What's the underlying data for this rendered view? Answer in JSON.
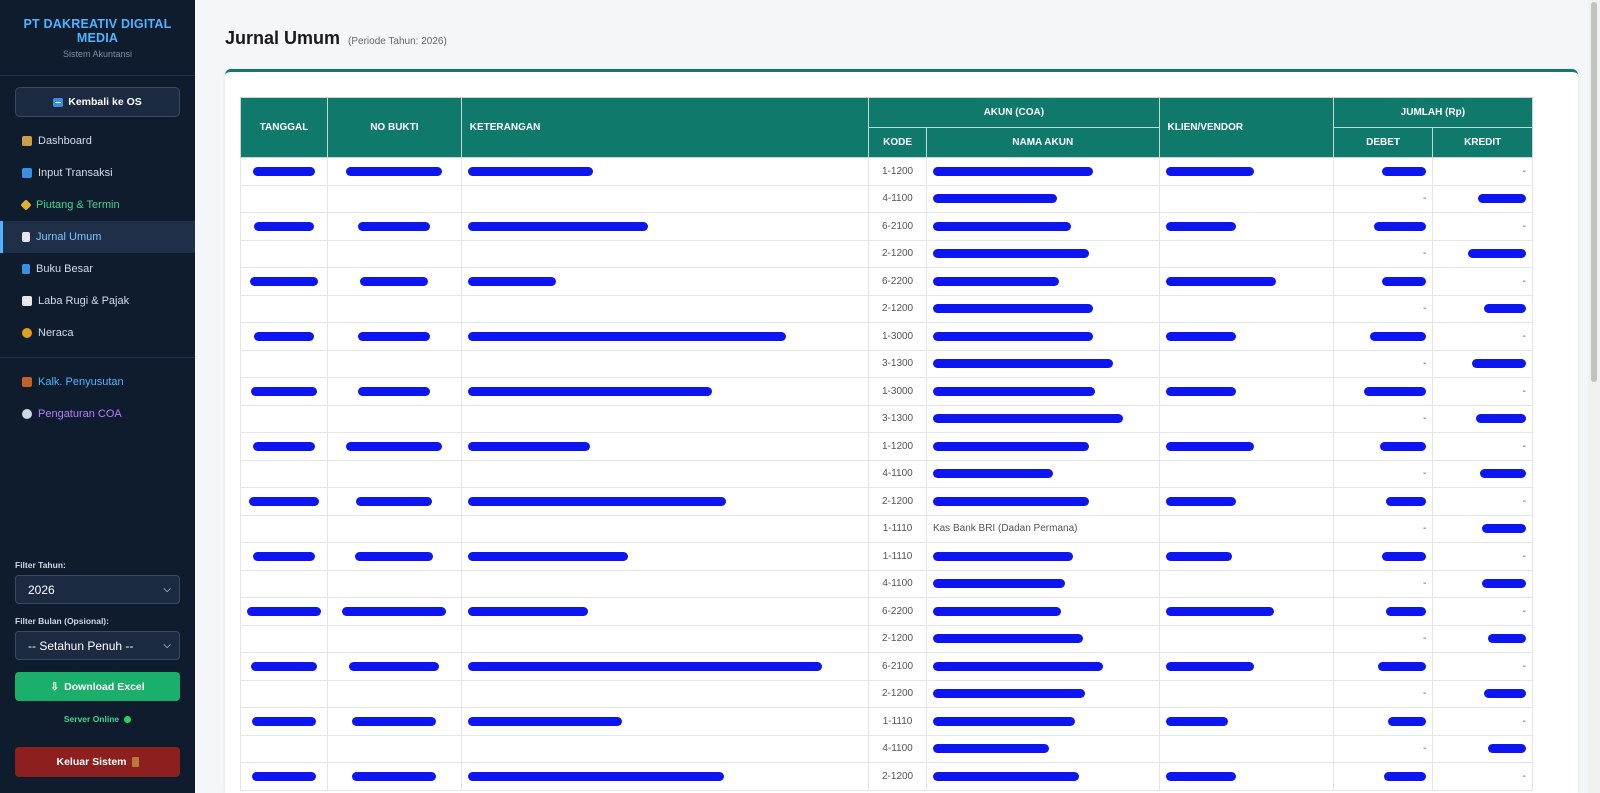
{
  "sidebar": {
    "company": "PT DAKREATIV DIGITAL MEDIA",
    "subtitle": "Sistem Akuntansi",
    "back_label": "Kembali ke OS",
    "nav": [
      {
        "label": "Dashboard",
        "icon": "chart-icon"
      },
      {
        "label": "Input Transaksi",
        "icon": "card-icon"
      },
      {
        "label": "Piutang & Termin",
        "icon": "tag-icon"
      },
      {
        "label": "Jurnal Umum",
        "icon": "journal-icon"
      },
      {
        "label": "Buku Besar",
        "icon": "book-icon"
      },
      {
        "label": "Laba Rugi & Pajak",
        "icon": "trend-icon"
      },
      {
        "label": "Neraca",
        "icon": "scale-icon"
      },
      {
        "label": "Kalk. Penyusutan",
        "icon": "abacus-icon"
      },
      {
        "label": "Pengaturan COA",
        "icon": "gear-icon"
      }
    ],
    "filter_year_label": "Filter Tahun:",
    "filter_year_value": "2026",
    "filter_month_label": "Filter Bulan (Opsional):",
    "filter_month_value": "-- Setahun Penuh --",
    "download_label": "Download Excel",
    "server_status": "Server Online",
    "logout_label": "Keluar Sistem"
  },
  "main": {
    "title": "Jurnal Umum",
    "period": "(Periode Tahun: 2026)",
    "table": {
      "headers": {
        "tanggal": "TANGGAL",
        "no_bukti": "NO BUKTI",
        "keterangan": "KETERANGAN",
        "akun": "AKUN (COA)",
        "kode": "KODE",
        "nama_akun": "NAMA AKUN",
        "klien": "KLIEN/VENDOR",
        "jumlah": "JUMLAH (Rp)",
        "debet": "DEBET",
        "kredit": "KREDIT"
      },
      "rows": [
        {
          "kode": "1-1200",
          "nama": "",
          "debet": "",
          "kredit": "-"
        },
        {
          "kode": "4-1100",
          "nama": "",
          "debet": "-",
          "kredit": ""
        },
        {
          "kode": "6-2100",
          "nama": "",
          "debet": "",
          "kredit": "-"
        },
        {
          "kode": "2-1200",
          "nama": "",
          "debet": "-",
          "kredit": ""
        },
        {
          "kode": "6-2200",
          "nama": "",
          "debet": "",
          "kredit": "-"
        },
        {
          "kode": "2-1200",
          "nama": "",
          "debet": "-",
          "kredit": ""
        },
        {
          "kode": "1-3000",
          "nama": "",
          "debet": "",
          "kredit": "-"
        },
        {
          "kode": "3-1300",
          "nama": "",
          "debet": "-",
          "kredit": ""
        },
        {
          "kode": "1-3000",
          "nama": "",
          "debet": "",
          "kredit": "-"
        },
        {
          "kode": "3-1300",
          "nama": "",
          "debet": "-",
          "kredit": ""
        },
        {
          "kode": "1-1200",
          "nama": "",
          "debet": "",
          "kredit": "-"
        },
        {
          "kode": "4-1100",
          "nama": "",
          "debet": "-",
          "kredit": ""
        },
        {
          "kode": "2-1200",
          "nama": "",
          "debet": "",
          "kredit": "-"
        },
        {
          "kode": "1-1110",
          "nama": "Kas Bank BRI (Dadan Permana)",
          "debet": "-",
          "kredit": ""
        },
        {
          "kode": "1-1110",
          "nama": "",
          "debet": "",
          "kredit": "-"
        },
        {
          "kode": "4-1100",
          "nama": "",
          "debet": "-",
          "kredit": ""
        },
        {
          "kode": "6-2200",
          "nama": "",
          "debet": "",
          "kredit": "-"
        },
        {
          "kode": "2-1200",
          "nama": "",
          "debet": "-",
          "kredit": ""
        },
        {
          "kode": "6-2100",
          "nama": "",
          "debet": "",
          "kredit": "-"
        },
        {
          "kode": "2-1200",
          "nama": "",
          "debet": "-",
          "kredit": ""
        },
        {
          "kode": "1-1110",
          "nama": "",
          "debet": "",
          "kredit": "-"
        },
        {
          "kode": "4-1100",
          "nama": "",
          "debet": "-",
          "kredit": ""
        },
        {
          "kode": "2-1200",
          "nama": "",
          "debet": "",
          "kredit": "-"
        }
      ]
    }
  },
  "colors": {
    "sidebar_bg": "#0f1c2e",
    "header_teal": "#0f7a6b",
    "redaction": "#0d16f0",
    "download_green": "#1aaf6b",
    "logout_red": "#8e1f1f"
  }
}
